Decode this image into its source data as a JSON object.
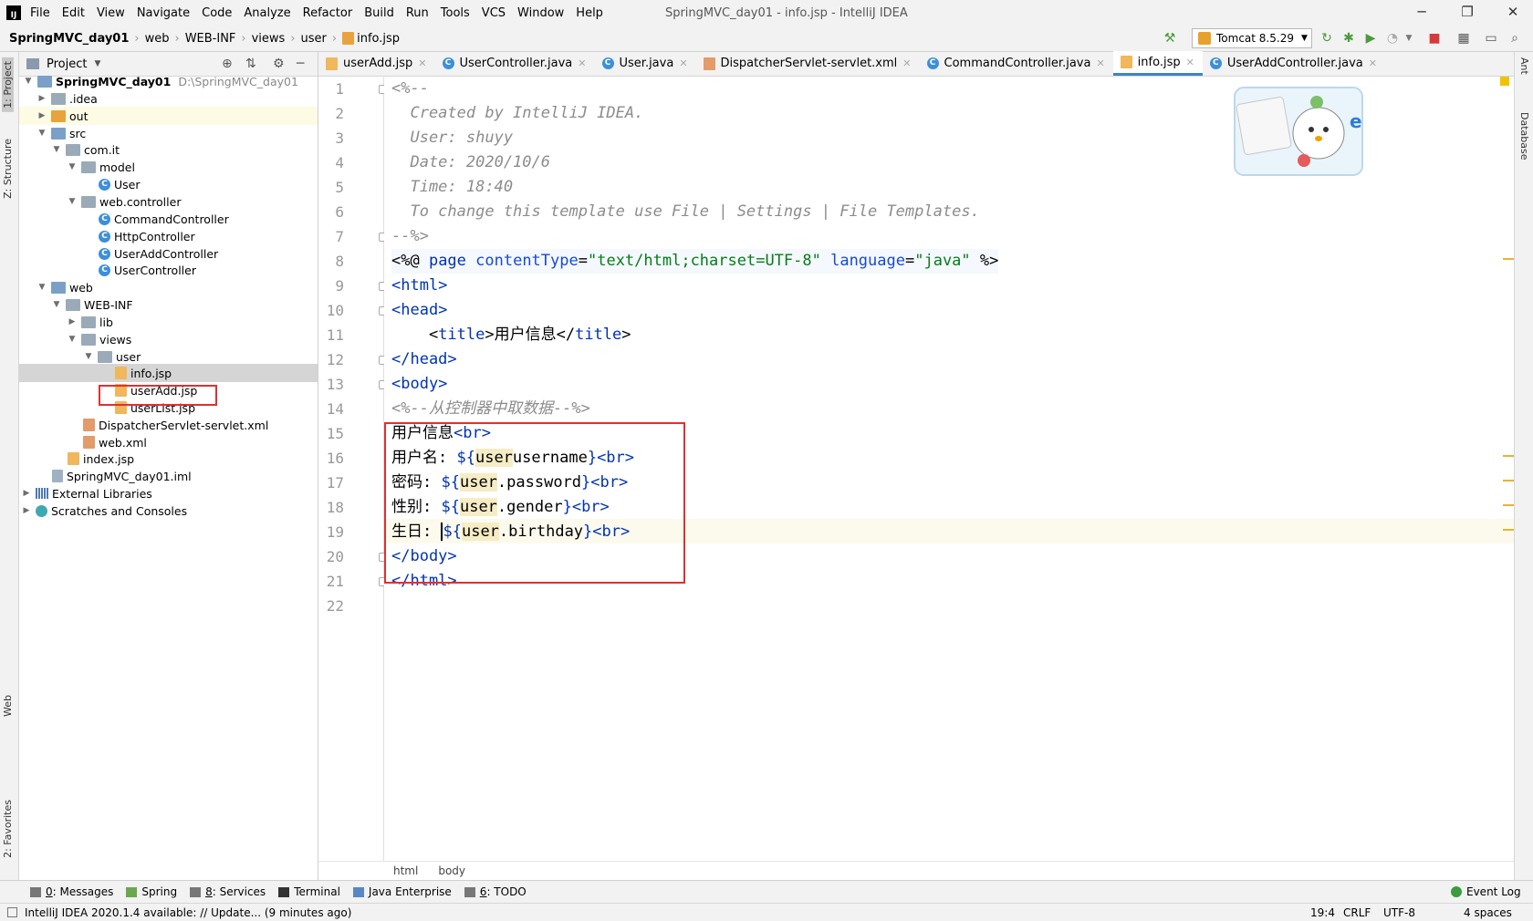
{
  "window": {
    "title": "SpringMVC_day01 - info.jsp - IntelliJ IDEA",
    "logo": "IJ"
  },
  "menu": [
    "File",
    "Edit",
    "View",
    "Navigate",
    "Code",
    "Analyze",
    "Refactor",
    "Build",
    "Run",
    "Tools",
    "VCS",
    "Window",
    "Help"
  ],
  "breadcrumb": [
    "SpringMVC_day01",
    "web",
    "WEB-INF",
    "views",
    "user",
    "info.jsp"
  ],
  "run_config": "Tomcat 8.5.29",
  "left_stripe": [
    "1: Project",
    "Z: Structure",
    "Web",
    "2: Favorites"
  ],
  "right_stripe": [
    "Ant",
    "Database"
  ],
  "project": {
    "header": "Project",
    "tree": [
      {
        "label": "SpringMVC_day01",
        "path": "D:\\SpringMVC_day01",
        "bold": true,
        "icon": "folder-icon"
      },
      {
        "label": ".idea",
        "icon": "folder-icon"
      },
      {
        "label": "out",
        "icon": "folder-icon"
      },
      {
        "label": "src",
        "icon": "folder-icon"
      },
      {
        "label": "com.it",
        "icon": "package-icon"
      },
      {
        "label": "model",
        "icon": "package-icon"
      },
      {
        "label": "User",
        "icon": "class-icon"
      },
      {
        "label": "web.controller",
        "icon": "package-icon"
      },
      {
        "label": "CommandController",
        "icon": "class-icon"
      },
      {
        "label": "HttpController",
        "icon": "class-icon"
      },
      {
        "label": "UserAddController",
        "icon": "class-icon"
      },
      {
        "label": "UserController",
        "icon": "class-icon"
      },
      {
        "label": "web",
        "icon": "folder-icon"
      },
      {
        "label": "WEB-INF",
        "icon": "folder-icon"
      },
      {
        "label": "lib",
        "icon": "folder-icon"
      },
      {
        "label": "views",
        "icon": "folder-icon"
      },
      {
        "label": "user",
        "icon": "folder-icon"
      },
      {
        "label": "info.jsp",
        "icon": "jsp-file-icon"
      },
      {
        "label": "userAdd.jsp",
        "icon": "jsp-file-icon"
      },
      {
        "label": "userList.jsp",
        "icon": "jsp-file-icon"
      },
      {
        "label": "DispatcherServlet-servlet.xml",
        "icon": "xml-file-icon"
      },
      {
        "label": "web.xml",
        "icon": "xml-file-icon"
      },
      {
        "label": "index.jsp",
        "icon": "jsp-file-icon"
      },
      {
        "label": "SpringMVC_day01.iml",
        "icon": "iml-file-icon"
      },
      {
        "label": "External Libraries",
        "icon": "library-icon"
      },
      {
        "label": "Scratches and Consoles",
        "icon": "scratches-icon"
      }
    ]
  },
  "tabs": [
    "userAdd.jsp",
    "UserController.java",
    "User.java",
    "DispatcherServlet-servlet.xml",
    "CommandController.java",
    "info.jsp",
    "UserAddController.java"
  ],
  "active_tab": "info.jsp",
  "code": {
    "line_numbers": [
      "1",
      "2",
      "3",
      "4",
      "5",
      "6",
      "7",
      "8",
      "9",
      "10",
      "11",
      "12",
      "13",
      "14",
      "15",
      "16",
      "17",
      "18",
      "19",
      "20",
      "21",
      "22"
    ],
    "l1": "<%--",
    "l2": "  Created by IntelliJ IDEA.",
    "l3": "  User: shuyy",
    "l4": "  Date: 2020/10/6",
    "l5": "  Time: 18:40",
    "l6": "  To change this template use File | Settings | File Templates.",
    "l7": "--%>",
    "l8": {
      "a": "<%@ ",
      "b": "page ",
      "c": "contentType",
      "d": "=",
      "e": "\"text/html;charset=UTF-8\"",
      "f": " language",
      "g": "=",
      "h": "\"java\"",
      "i": " %>"
    },
    "l9": "<html>",
    "l10": "<head>",
    "l11": {
      "a": "    <",
      "b": "title",
      "c": ">用户信息</",
      "d": "title",
      "e": ">"
    },
    "l12": "</head>",
    "l13": "<body>",
    "l14": "<%--从控制器中取数据--%>",
    "l15": {
      "a": "用户信息",
      "b": "<br>"
    },
    "l16": {
      "a": "用户名: ",
      "b": "${",
      "c": "user",
      ".": ".",
      "d": "username",
      "e": "}",
      "f": "<br>"
    },
    "l17": {
      "a": "密码: ",
      "b": "${",
      "c": "user",
      "d": ".password",
      "e": "}",
      "f": "<br>"
    },
    "l18": {
      "a": "性别: ",
      "b": "${",
      "c": "user",
      "d": ".gender",
      "e": "}",
      "f": "<br>"
    },
    "l19": {
      "a": "生日: ",
      "b": "${",
      "c": "user",
      "d": ".birthday",
      "e": "}",
      "f": "<br>"
    },
    "l20": "</body>",
    "l21": "</html>"
  },
  "editor_breadcrumb": [
    "html",
    "body"
  ],
  "tool_windows": [
    {
      "key": "0",
      "label": ": Messages"
    },
    {
      "key": "",
      "label": "Spring"
    },
    {
      "key": "8",
      "label": ": Services"
    },
    {
      "key": "",
      "label": "Terminal"
    },
    {
      "key": "",
      "label": "Java Enterprise"
    },
    {
      "key": "6",
      "label": ": TODO"
    }
  ],
  "event_log": "Event Log",
  "status": {
    "message": "IntelliJ IDEA 2020.1.4 available: // Update... (9 minutes ago)",
    "position": "19:4",
    "line_sep": "CRLF",
    "encoding": "UTF-8",
    "indent": "4 spaces"
  }
}
